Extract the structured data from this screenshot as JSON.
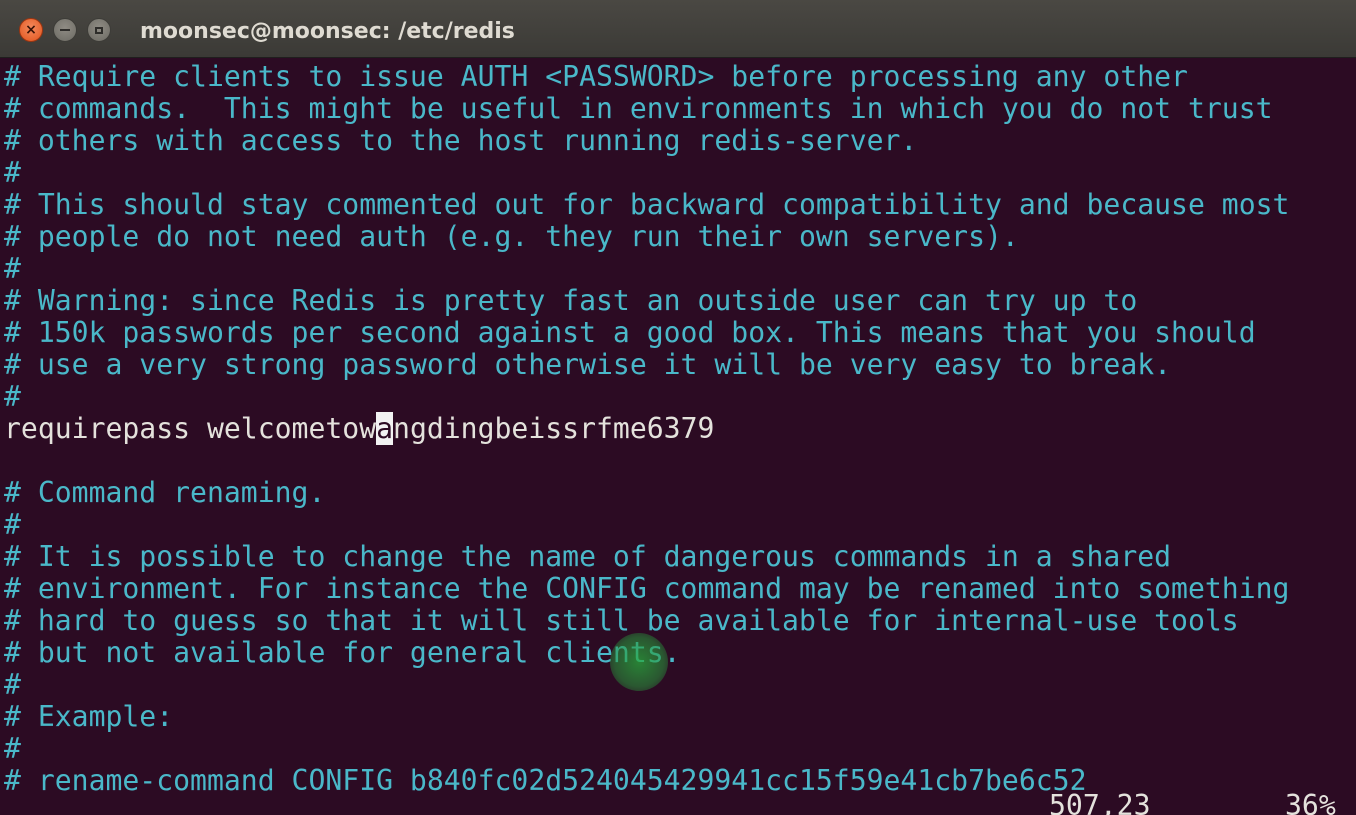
{
  "window": {
    "title": "moonsec@moonsec: /etc/redis"
  },
  "editor": {
    "lines": [
      "# Require clients to issue AUTH <PASSWORD> before processing any other",
      "# commands.  This might be useful in environments in which you do not trust",
      "# others with access to the host running redis-server.",
      "#",
      "# This should stay commented out for backward compatibility and because most",
      "# people do not need auth (e.g. they run their own servers).",
      "#",
      "# Warning: since Redis is pretty fast an outside user can try up to",
      "# 150k passwords per second against a good box. This means that you should",
      "# use a very strong password otherwise it will be very easy to break.",
      "#",
      "",
      "",
      "# Command renaming.",
      "#",
      "# It is possible to change the name of dangerous commands in a shared",
      "# environment. For instance the CONFIG command may be renamed into something",
      "# hard to guess so that it will still be available for internal-use tools",
      "# but not available for general clients.",
      "#",
      "# Example:",
      "#",
      "# rename-command CONFIG b840fc02d524045429941cc15f59e41cb7be6c52"
    ],
    "requirepass_line": {
      "before_cursor": "requirepass welcometow",
      "cursor_char": "a",
      "after_cursor": "ngdingbeissrfme6379"
    }
  },
  "status": {
    "position": "507,23",
    "percent": "36%"
  },
  "colors": {
    "background": "#2c0b23",
    "comment": "#4ab8c9",
    "text": "#e4e2dc"
  }
}
